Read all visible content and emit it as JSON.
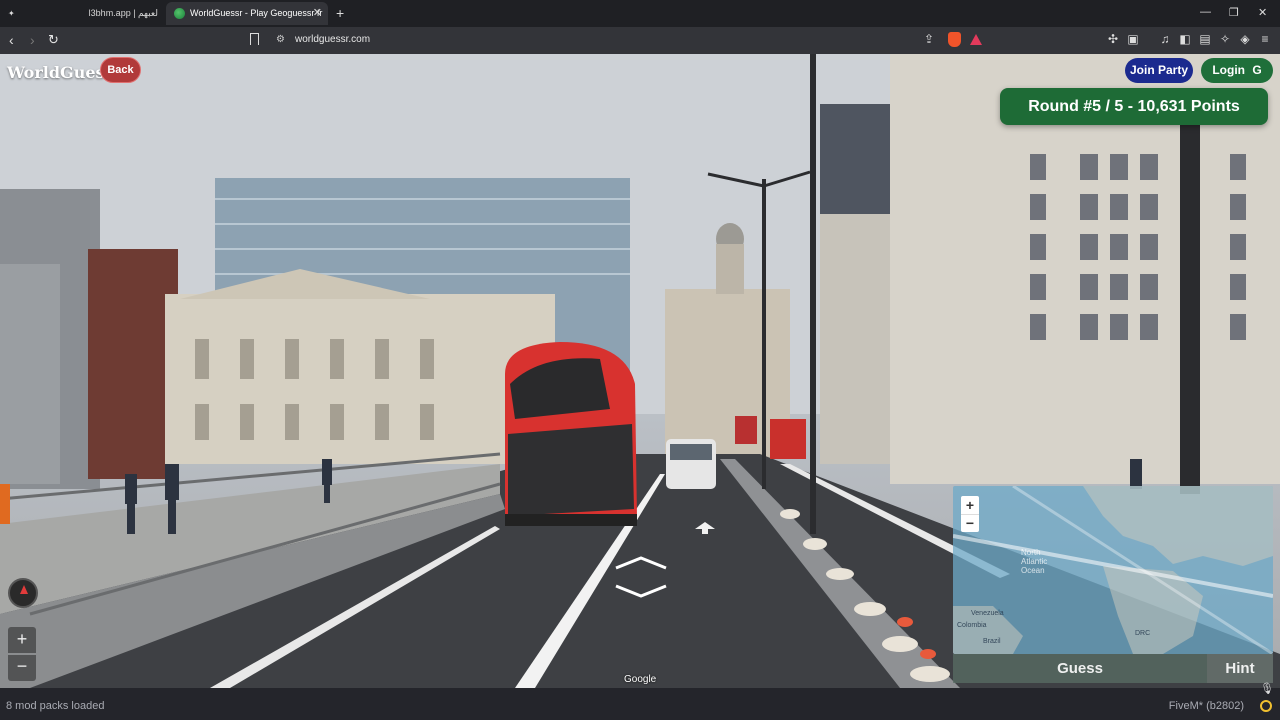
{
  "browser": {
    "tabs": [
      {
        "label": "l3bhm.app | لعبهم"
      },
      {
        "label": "WorldGuessr - Play Geoguessr fr"
      }
    ],
    "url": "worldguessr.com"
  },
  "game": {
    "brand": "WorldGuessr",
    "back_label": "Back",
    "join_label": "Join Party",
    "login_label": "Login",
    "round_text": "Round #5 / 5 - 10,631 Points",
    "google_label": "Google",
    "zoom_in": "+",
    "zoom_out": "−",
    "map": {
      "labels": [
        "North Atlantic Ocean",
        "Venezuela",
        "Colombia",
        "Brazil",
        "DRC"
      ],
      "guess_label": "Guess",
      "hint_label": "Hint"
    }
  },
  "status": {
    "left": "8 mod packs loaded",
    "right": "FiveM* (b2802)"
  },
  "colors": {
    "bus_red": "#d8322f",
    "banner_green": "#1e6b36",
    "join_blue": "#1b2a8f",
    "back_red": "#b13a3a"
  }
}
